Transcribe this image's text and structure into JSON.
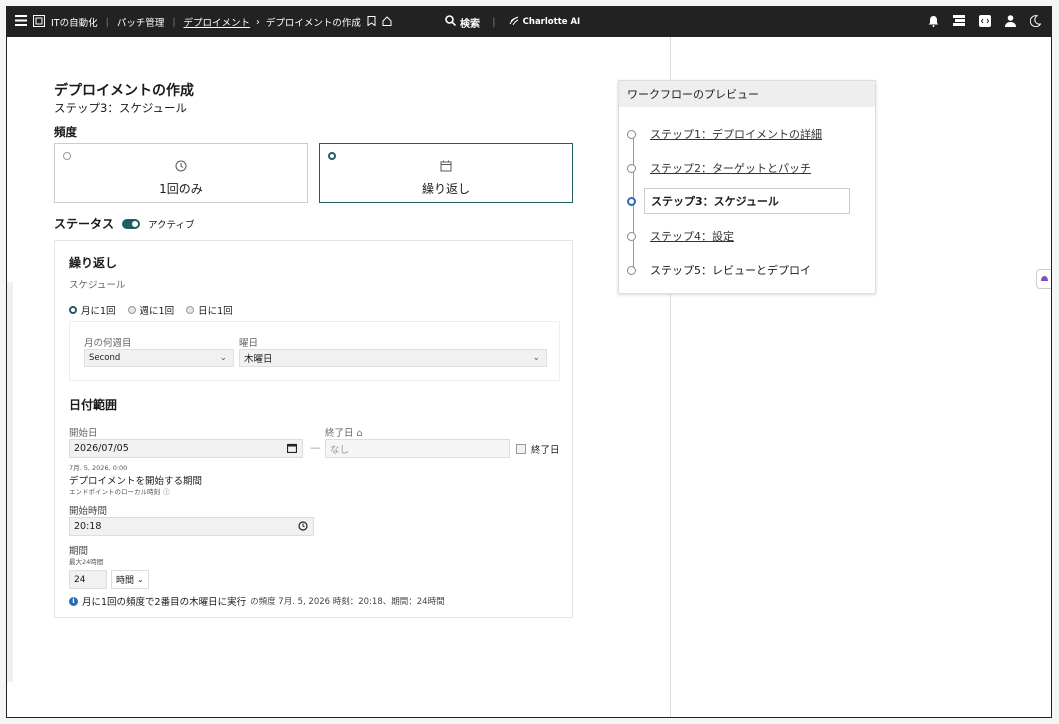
{
  "topbar": {
    "breadcrumb": {
      "app": "ITの自動化",
      "section": "パッチ管理",
      "parent": "デプロイメント",
      "current": "デプロイメントの作成"
    },
    "search_label": "検索",
    "ai_label": "Charlotte AI"
  },
  "page": {
    "title": "デプロイメントの作成",
    "step": "ステップ3：スケジュール",
    "frequency_label": "頻度",
    "option_once": "1回のみ",
    "option_recurring": "繰り返し",
    "status_label": "ステータス",
    "status_value": "アクティブ"
  },
  "recurrence": {
    "title": "繰り返し",
    "schedule_label": "スケジュール",
    "options": [
      "月に1回",
      "週に1回",
      "日に1回"
    ],
    "selected_option": "月に1回",
    "week_of_month_label": "月の何週目",
    "week_of_month_value": "Second",
    "day_of_week_label": "曜日",
    "day_of_week_value": "木曜日"
  },
  "date_range": {
    "title": "日付範囲",
    "start_label": "開始日",
    "start_value": "2026/07/05",
    "start_hint": "7月. 5, 2026, 0:00",
    "end_label": "終了日",
    "end_placeholder": "なし",
    "end_checkbox_label": "終了日",
    "window_title": "デプロイメントを開始する期間",
    "window_hint": "エンドポイントのローカル時刻",
    "start_time_label": "開始時間",
    "start_time_value": "20:18",
    "duration_label": "期間",
    "duration_hint": "最大24時間",
    "duration_value": "24",
    "duration_unit": "時間",
    "summary_main": "月に1回の頻度で2番目の木曜日に実行",
    "summary_rest": "の頻度 7月. 5, 2026 時刻：20:18、期間：24時間"
  },
  "workflow": {
    "title": "ワークフローのプレビュー",
    "steps": [
      "ステップ1：デプロイメントの詳細",
      "ステップ2：ターゲットとパッチ",
      "ステップ3：スケジュール",
      "ステップ4：設定",
      "ステップ5：レビューとデプロイ"
    ]
  },
  "colors": {
    "accent": "#1f5f63",
    "topbar": "#222222",
    "current_step": "#2b6cb0"
  }
}
